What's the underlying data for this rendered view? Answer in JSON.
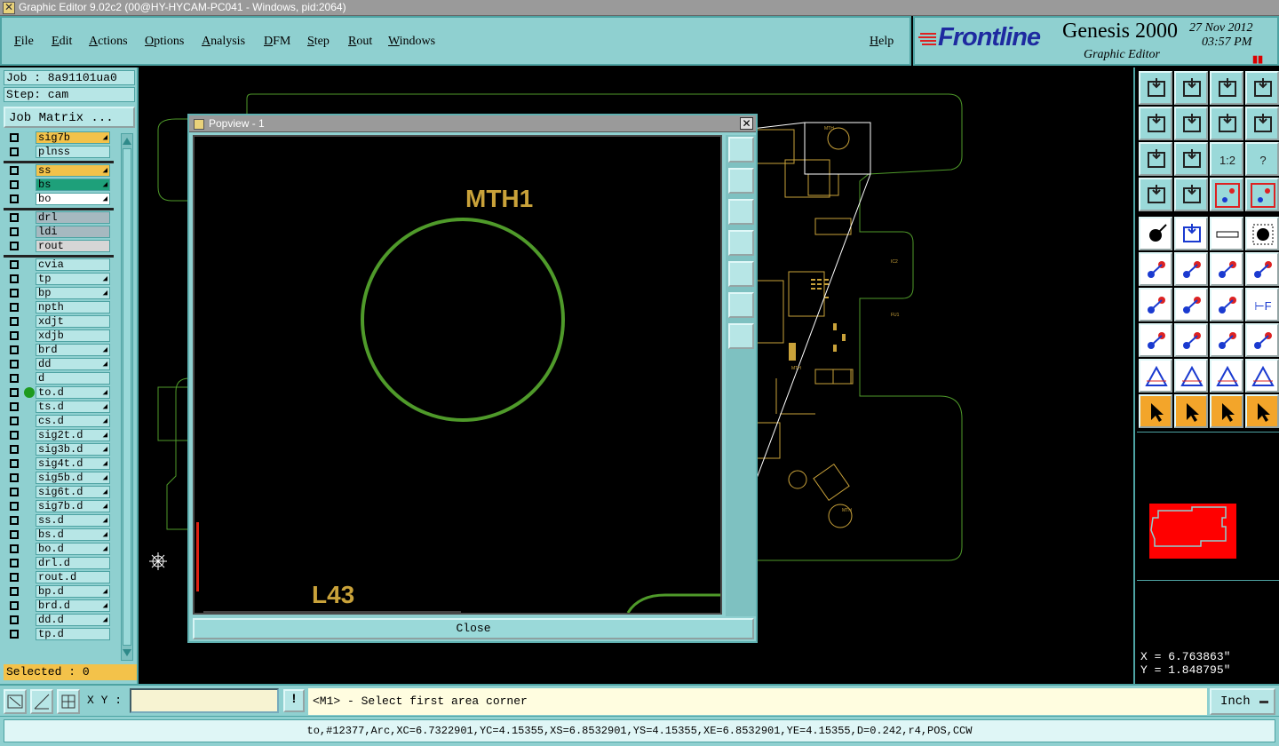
{
  "window": {
    "title": "Graphic Editor 9.02c2 (00@HY-HYCAM-PC041 - Windows, pid:2064)"
  },
  "menu": {
    "items": [
      "File",
      "Edit",
      "Actions",
      "Options",
      "Analysis",
      "DFM",
      "Step",
      "Rout",
      "Windows"
    ],
    "help": "Help"
  },
  "brand": {
    "logo": "Frontline",
    "product": "Genesis 2000",
    "subtitle": "Graphic Editor",
    "date": "27 Nov 2012",
    "time": "03:57 PM",
    "pause_glyph": "▮▮"
  },
  "left": {
    "job": "Job : 8a91101ua0",
    "step": "Step: cam",
    "job_matrix": "Job Matrix ...",
    "selected": "Selected : 0",
    "layers": [
      {
        "name": "sig7b",
        "color": "#f3c24a",
        "arrow": true
      },
      {
        "name": "plnss",
        "color": "#b7e6e6",
        "arrow": false
      },
      {
        "name": "ss",
        "color": "#f3c24a",
        "arrow": true
      },
      {
        "name": "bs",
        "color": "#1ea07a",
        "arrow": true
      },
      {
        "name": "bo",
        "color": "#ffffff",
        "arrow": true
      },
      {
        "name": "drl",
        "color": "#a6b9c0",
        "arrow": false
      },
      {
        "name": "ldi",
        "color": "#a6b9c0",
        "arrow": false
      },
      {
        "name": "rout",
        "color": "#d6d6d6",
        "arrow": false
      },
      {
        "name": "cvia",
        "color": "#b7e6e6",
        "arrow": false
      },
      {
        "name": "tp",
        "color": "#b7e6e6",
        "arrow": true
      },
      {
        "name": "bp",
        "color": "#b7e6e6",
        "arrow": true
      },
      {
        "name": "npth",
        "color": "#b7e6e6",
        "arrow": false
      },
      {
        "name": "xdjt",
        "color": "#b7e6e6",
        "arrow": false
      },
      {
        "name": "xdjb",
        "color": "#b7e6e6",
        "arrow": false
      },
      {
        "name": "brd",
        "color": "#b7e6e6",
        "arrow": true
      },
      {
        "name": "dd",
        "color": "#b7e6e6",
        "arrow": true
      },
      {
        "name": "d",
        "color": "#b7e6e6",
        "arrow": false
      },
      {
        "name": "to.d",
        "color": "#b7e6e6",
        "arrow": true,
        "active": true
      },
      {
        "name": "ts.d",
        "color": "#b7e6e6",
        "arrow": true
      },
      {
        "name": "cs.d",
        "color": "#b7e6e6",
        "arrow": true
      },
      {
        "name": "sig2t.d",
        "color": "#b7e6e6",
        "arrow": true
      },
      {
        "name": "sig3b.d",
        "color": "#b7e6e6",
        "arrow": true
      },
      {
        "name": "sig4t.d",
        "color": "#b7e6e6",
        "arrow": true
      },
      {
        "name": "sig5b.d",
        "color": "#b7e6e6",
        "arrow": true
      },
      {
        "name": "sig6t.d",
        "color": "#b7e6e6",
        "arrow": true
      },
      {
        "name": "sig7b.d",
        "color": "#b7e6e6",
        "arrow": true
      },
      {
        "name": "ss.d",
        "color": "#b7e6e6",
        "arrow": true
      },
      {
        "name": "bs.d",
        "color": "#b7e6e6",
        "arrow": true
      },
      {
        "name": "bo.d",
        "color": "#b7e6e6",
        "arrow": true
      },
      {
        "name": "drl.d",
        "color": "#b7e6e6",
        "arrow": false
      },
      {
        "name": "rout.d",
        "color": "#b7e6e6",
        "arrow": false
      },
      {
        "name": "bp.d",
        "color": "#b7e6e6",
        "arrow": true
      },
      {
        "name": "brd.d",
        "color": "#b7e6e6",
        "arrow": true
      },
      {
        "name": "dd.d",
        "color": "#b7e6e6",
        "arrow": true
      },
      {
        "name": "tp.d",
        "color": "#b7e6e6",
        "arrow": false
      }
    ]
  },
  "popview": {
    "title": "Popview - 1",
    "close_glyph": "✕",
    "close_button": "Close",
    "label_mth": "MTH1",
    "label_l43": "L43"
  },
  "coords": {
    "x": "X = 6.763863\"",
    "y": "Y = 1.848795\""
  },
  "bottom": {
    "xy_label": "X Y :",
    "xy_value": "",
    "excl": "!",
    "prompt": "<M1> - Select first area corner",
    "units": "Inch"
  },
  "status": "to,#12377,Arc,XC=6.7322901,YC=4.15355,XS=6.8532901,YS=4.15355,XE=6.8532901,YE=4.15355,D=0.242,r4,POS,CCW",
  "colors": {
    "panel": "#8fd0d0",
    "board_outline": "#4f9a2a",
    "copper": "#c9a23a",
    "pad_label": "#c9a23a"
  },
  "icons": {
    "tools": [
      "zoom-home-icon",
      "zoom-in-icon",
      "zoom-home-house-icon",
      "split-view-icon",
      "pan-left-icon",
      "pan-right-icon",
      "swap-icon",
      "rotate-icon",
      "fit-screen-icon",
      "fit-center-icon",
      "scale-1to2-icon",
      "help-query-icon",
      "measure-settings-icon",
      "grid-icon",
      "snap-red-icon",
      "snap-red-alt-icon",
      "add-pad-icon",
      "add-line-icon",
      "ruler-icon",
      "dotted-pad-icon",
      "connect-icon",
      "cross-icon",
      "move-icon",
      "move-alt-icon",
      "draw-angle-icon",
      "draw-slope-icon",
      "arc-icon",
      "text-icon",
      "move-pad-icon",
      "break-line-icon",
      "measure-distance-icon",
      "contour-icon",
      "triangle-icon",
      "triangle-alt-icon",
      "triangle-split-icon",
      "triangle-cross-icon",
      "select-arrow-icon",
      "select-box-icon",
      "select-box-orange-icon",
      "route-select-icon"
    ]
  }
}
